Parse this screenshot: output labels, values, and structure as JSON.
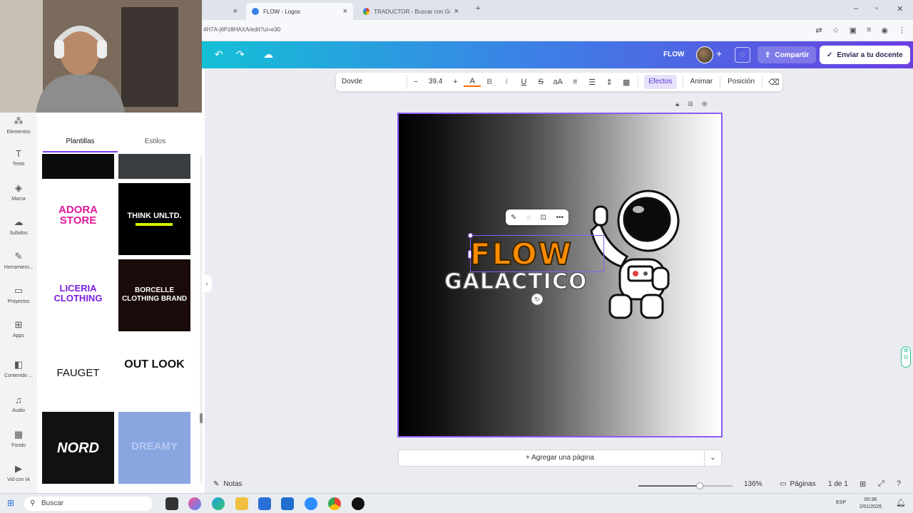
{
  "browser": {
    "tabs": [
      {
        "label": "FLOW - Logos",
        "active": true
      },
      {
        "label": "TRADUCTOR - Buscar con Goo",
        "active": false
      }
    ],
    "url": "4H7A-j6Pz8HAXA/edit?ui=e30"
  },
  "header": {
    "project_name": "FLOW",
    "share_label": "Compartir",
    "send_label": "Enviar a tu docente"
  },
  "toolbar": {
    "font_name": "Dovde",
    "font_size": "39.4",
    "minus": "−",
    "plus": "+",
    "effects_label": "Efectos",
    "animate_label": "Animar",
    "position_label": "Posición",
    "bold": "B",
    "italic": "I",
    "underline": "U",
    "strike": "S",
    "case": "aA",
    "text_color_glyph": "A"
  },
  "design": {
    "title_line1": "FLOW",
    "title_line2": "GALACTICO"
  },
  "add_page_label": "+ Agregar una página",
  "status": {
    "notes_label": "Notas",
    "zoom": "136%",
    "zoom_level": 0.65,
    "pages_label": "Páginas",
    "page_count": "1 de 1"
  },
  "sidebar": {
    "items": [
      "Elementos",
      "Texto",
      "Marca",
      "Subidos",
      "Herramient...",
      "Proyectos",
      "Apps",
      "Contenido ...",
      "Audio",
      "Fondo",
      "Vid con IA"
    ]
  },
  "panel": {
    "tabs": [
      "Plantillas",
      "Estilos"
    ],
    "templates": [
      "ADORA STORE",
      "THINK UNLTD.",
      "LICERIA CLOTHING",
      "BORCELLE CLOTHING BRAND",
      "FAUGET",
      "OUT LOOK",
      "NORD",
      "DREAMY"
    ]
  },
  "taskbar": {
    "search_label": "Buscar",
    "lang": "ESP",
    "time": "00:38",
    "date": "2/01/2026"
  },
  "colors": {
    "accent": "#8b5cf6",
    "flow_orange": "#ff8c00"
  }
}
